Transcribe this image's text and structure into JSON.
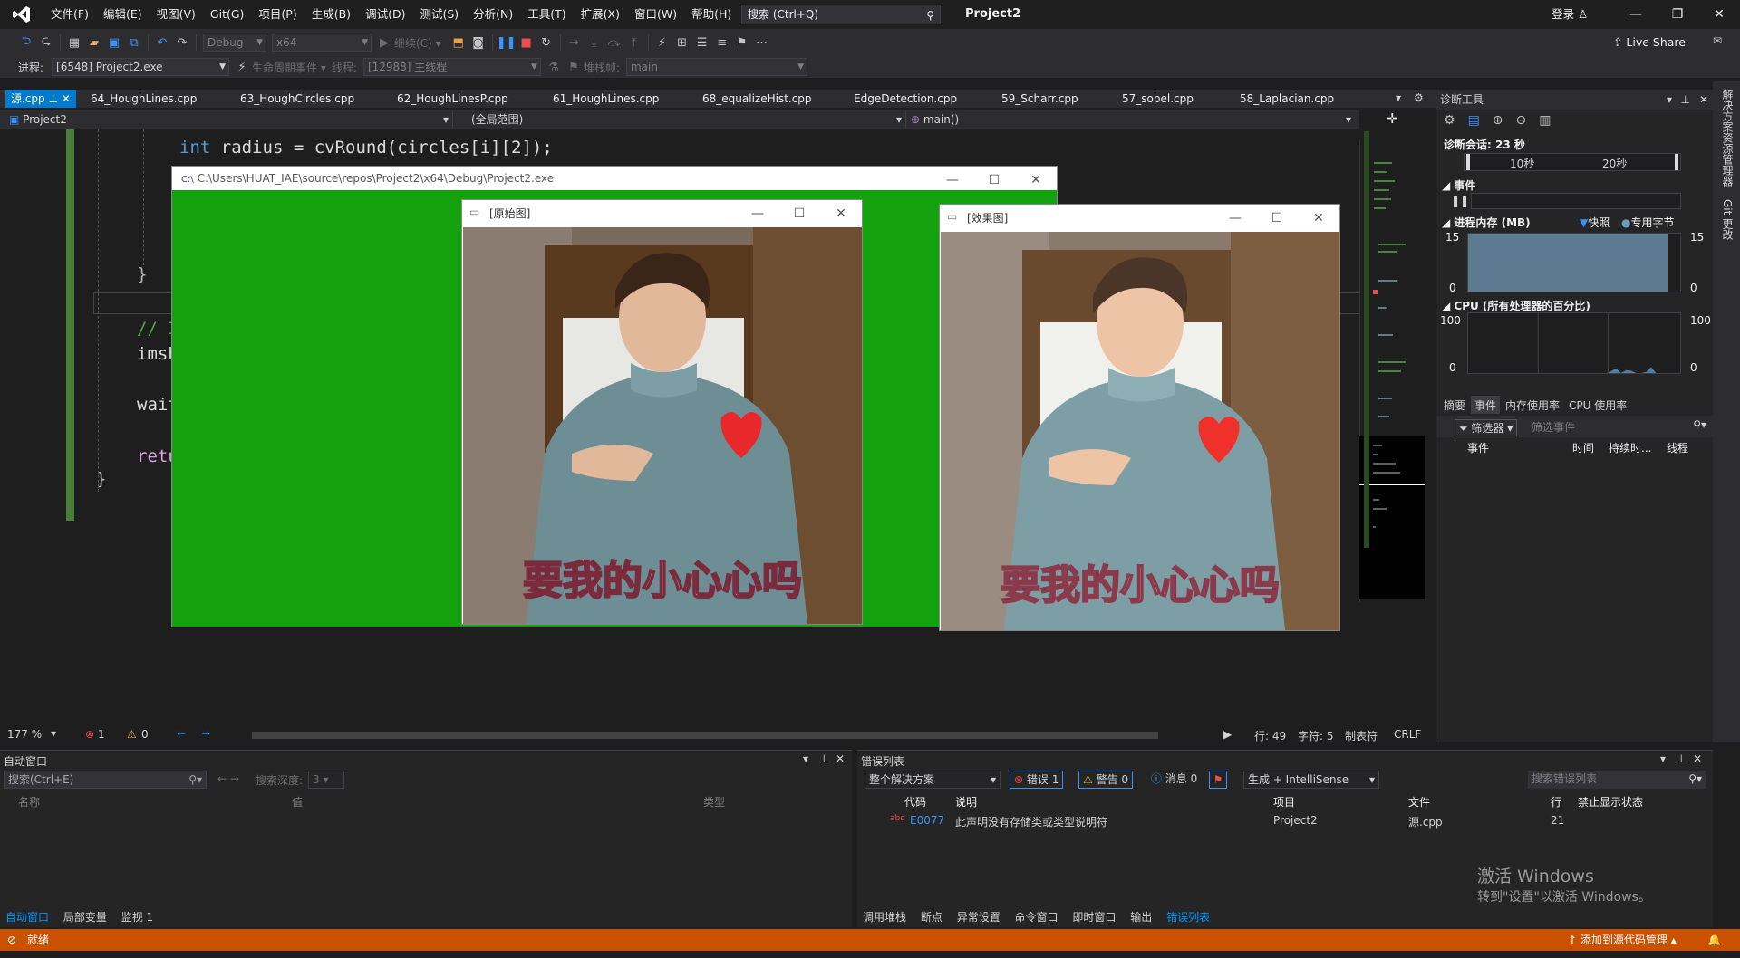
{
  "titlebar": {
    "menus": [
      "文件(F)",
      "编辑(E)",
      "视图(V)",
      "Git(G)",
      "项目(P)",
      "生成(B)",
      "调试(D)",
      "测试(S)",
      "分析(N)",
      "工具(T)",
      "扩展(X)",
      "窗口(W)",
      "帮助(H)"
    ],
    "search_placeholder": "搜索 (Ctrl+Q)",
    "solution": "Project2",
    "login": "登录"
  },
  "toolbar": {
    "config": "Debug",
    "platform": "x64",
    "continue": "继续(C) ▾",
    "live_share": "Live Share"
  },
  "debugbar": {
    "process_label": "进程:",
    "process": "[6548] Project2.exe",
    "lifecycle": "生命周期事件 ▾",
    "thread_label": "线程:",
    "thread": "[12988] 主线程",
    "stack_label": "堆栈帧:",
    "stack": "main"
  },
  "tabs": [
    "源.cpp",
    "64_HoughLines.cpp",
    "63_HoughCircles.cpp",
    "62_HoughLinesP.cpp",
    "61_HoughLines.cpp",
    "68_equalizeHist.cpp",
    "EdgeDetection.cpp",
    "59_Scharr.cpp",
    "57_sobel.cpp",
    "58_Laplacian.cpp"
  ],
  "navbar": {
    "project": "Project2",
    "scope": "(全局范围)",
    "func": "main()"
  },
  "code": {
    "line1_kw": "int",
    "line1_rest": " radius = cvRound(circles[i][2]);",
    "brace_close": "}",
    "comment_frag": "// I",
    "imsh": "imsh",
    "wait": "wait",
    "retu": "retu",
    "brace_end": "}"
  },
  "console_window": {
    "title": "C:\\Users\\HUAT_IAE\\source\\repos\\Project2\\x64\\Debug\\Project2.exe"
  },
  "window_original": {
    "title": "[原始图]",
    "caption": "要我的小心心吗"
  },
  "window_effect": {
    "title": "[效果图]",
    "caption": "要我的小心心吗"
  },
  "editor_status": {
    "zoom": "177 %",
    "errors": "1",
    "warnings": "0",
    "line": "行: 49",
    "char": "字符: 5",
    "tab": "制表符",
    "eol": "CRLF"
  },
  "diag": {
    "title": "诊断工具",
    "session": "诊断会话: 23 秒",
    "t10": "10秒",
    "t20": "20秒",
    "events": "事件",
    "memory": "进程内存 (MB)",
    "snapshot": "快照",
    "private_bytes": "专用字节",
    "mem_max": "15",
    "mem_min": "0",
    "cpu": "CPU (所有处理器的百分比)",
    "cpu_max": "100",
    "cpu_min": "0",
    "tabs": [
      "摘要",
      "事件",
      "内存使用率",
      "CPU 使用率"
    ],
    "filter": "筛选器",
    "filter_events": "筛选事件",
    "cols": [
      "事件",
      "时间",
      "持续时...",
      "线程"
    ],
    "cpu_series": [
      0,
      0,
      0,
      0,
      0,
      0,
      0,
      0,
      0,
      0,
      0,
      0,
      0,
      0,
      0,
      0,
      0,
      0,
      3,
      8,
      0,
      5,
      4,
      0,
      0,
      2,
      10,
      0,
      0
    ]
  },
  "right_side": [
    "解决方案资源管理器",
    "Git 更改"
  ],
  "autos": {
    "title": "自动窗口",
    "search": "搜索(Ctrl+E)",
    "depth_label": "搜索深度:",
    "depth": "3",
    "cols": [
      "名称",
      "值",
      "类型"
    ],
    "tabs": [
      "自动窗口",
      "局部变量",
      "监视 1"
    ]
  },
  "errors": {
    "title": "错误列表",
    "scope": "整个解决方案",
    "err_btn": "错误 1",
    "warn_btn": "警告 0",
    "msg_btn": "消息 0",
    "build": "生成 + IntelliSense",
    "search": "搜索错误列表",
    "cols": [
      "代码",
      "说明",
      "项目",
      "文件",
      "行",
      "禁止显示状态"
    ],
    "rows": [
      {
        "code": "E0077",
        "desc": "此声明没有存储类或类型说明符",
        "project": "Project2",
        "file": "源.cpp",
        "line": "21",
        "state": ""
      }
    ],
    "tabs": [
      "调用堆栈",
      "断点",
      "异常设置",
      "命令窗口",
      "即时窗口",
      "输出",
      "错误列表"
    ]
  },
  "watermark": {
    "line1": "激活 Windows",
    "line2": "转到\"设置\"以激活 Windows。"
  },
  "status": {
    "ready": "就绪",
    "source_control": "添加到源代码管理"
  }
}
